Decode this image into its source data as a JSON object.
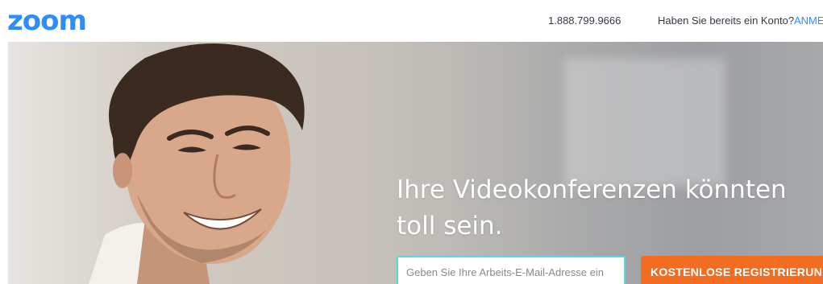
{
  "header": {
    "logo_text": "zoom",
    "phone": "1.888.799.9666",
    "account_question": "Haben Sie bereits ein Konto?",
    "signin_label": "ANME"
  },
  "hero": {
    "headline": "Ihre Videokonferenzen könnten toll sein.",
    "email_placeholder": "Geben Sie Ihre Arbeits-E-Mail-Adresse ein",
    "signup_button_label": "KOSTENLOSE REGISTRIERUN"
  },
  "colors": {
    "brand_blue": "#2d8cff",
    "signup_orange": "#f26d21",
    "input_border": "#5fd4e6"
  }
}
